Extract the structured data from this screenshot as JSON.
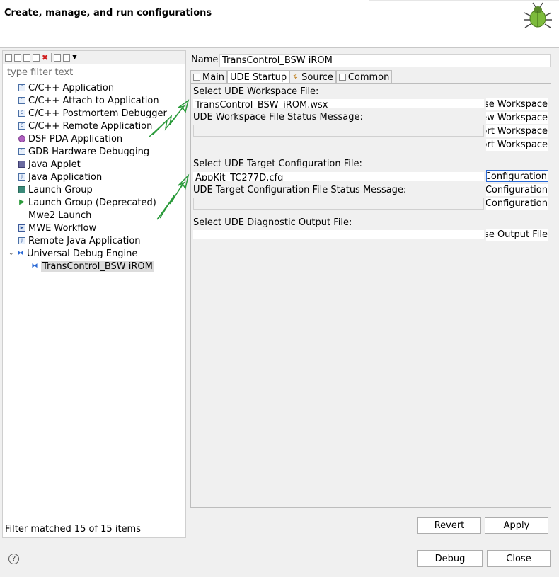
{
  "header": {
    "title": "Create, manage, and run configurations"
  },
  "left": {
    "filter_placeholder": "type filter text",
    "tree": [
      {
        "label": "C/C++ Application",
        "icon": "c-app-icon"
      },
      {
        "label": "C/C++ Attach to Application",
        "icon": "c-attach-icon"
      },
      {
        "label": "C/C++ Postmortem Debugger",
        "icon": "c-postmortem-icon"
      },
      {
        "label": "C/C++ Remote Application",
        "icon": "c-remote-icon"
      },
      {
        "label": "DSF PDA Application",
        "icon": "dsf-pda-icon"
      },
      {
        "label": "GDB Hardware Debugging",
        "icon": "gdb-hw-icon"
      },
      {
        "label": "Java Applet",
        "icon": "java-applet-icon"
      },
      {
        "label": "Java Application",
        "icon": "java-app-icon"
      },
      {
        "label": "Launch Group",
        "icon": "launch-group-icon"
      },
      {
        "label": "Launch Group (Deprecated)",
        "icon": "launch-group-deprecated-icon"
      },
      {
        "label": "Mwe2 Launch",
        "icon": ""
      },
      {
        "label": "MWE Workflow",
        "icon": "mwe-workflow-icon"
      },
      {
        "label": "Remote Java Application",
        "icon": "remote-java-icon"
      },
      {
        "label": "Universal Debug Engine",
        "icon": "ude-icon"
      },
      {
        "label": "TransControl_BSW iROM",
        "icon": "ude-config-icon"
      }
    ],
    "status": "Filter matched 15 of 15 items"
  },
  "right": {
    "name_label": "Name:",
    "name_value": "TransControl_BSW iROM",
    "tabs": [
      "Main",
      "UDE Startup",
      "Source",
      "Common"
    ],
    "workspace": {
      "label": "Select UDE Workspace File:",
      "value": "TransControl_BSW_iROM.wsx",
      "status_label": "UDE Workspace File Status Message:",
      "buttons": [
        "Browse Workspace",
        "New Workspace",
        "Import Workspace",
        "Export Workspace"
      ]
    },
    "target": {
      "label": "Select UDE Target Configuration File:",
      "value": "AppKit_TC277D.cfg",
      "status_label": "UDE Target Configuration File Status Message:",
      "buttons": [
        "Browse Configuration",
        "Create Configuration",
        "Import Configuration"
      ]
    },
    "diagnostic": {
      "label": "Select UDE Diagnostic Output File:",
      "value": "",
      "buttons": [
        "Browse Output File"
      ]
    },
    "revert": "Revert",
    "apply": "Apply"
  },
  "footer": {
    "help": "?",
    "debug": "Debug",
    "close": "Close"
  },
  "colors": {
    "annotation_arrow": "#2a9a3a",
    "focus_border": "#2b6ad6"
  }
}
